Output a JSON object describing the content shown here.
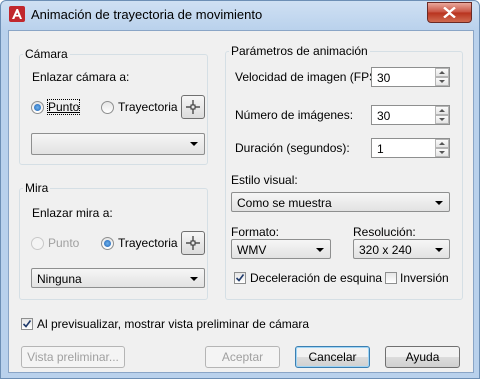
{
  "window": {
    "title": "Animación de trayectoria de movimiento"
  },
  "camera": {
    "group_label": "Cámara",
    "link_label": "Enlazar cámara a:",
    "option_point": "Punto",
    "option_path": "Trayectoria",
    "selected": "Punto",
    "dropdown_value": ""
  },
  "target": {
    "group_label": "Mira",
    "link_label": "Enlazar mira a:",
    "option_point": "Punto",
    "option_path": "Trayectoria",
    "selected": "Trayectoria",
    "dropdown_value": "Ninguna"
  },
  "animation": {
    "group_label": "Parámetros de animación",
    "fps_label": "Velocidad de imagen (FPS):",
    "fps_value": "30",
    "frames_label": "Número de imágenes:",
    "frames_value": "30",
    "duration_label": "Duración (segundos):",
    "duration_value": "1",
    "visual_style_label": "Estilo visual:",
    "visual_style_value": "Como se muestra",
    "format_label": "Formato:",
    "format_value": "WMV",
    "resolution_label": "Resolución:",
    "resolution_value": "320 x 240",
    "corner_decel_label": "Deceleración de esquina",
    "corner_decel_checked": true,
    "reverse_label": "Inversión",
    "reverse_checked": false
  },
  "preview_checkbox": {
    "label": "Al previsualizar, mostrar vista preliminar de cámara",
    "checked": true
  },
  "buttons": {
    "preview": "Vista preliminar...",
    "ok": "Aceptar",
    "cancel": "Cancelar",
    "help": "Ayuda"
  },
  "icons": [
    "autocad-app-icon",
    "close-icon",
    "pick-point-icon",
    "dropdown-arrow-icon",
    "checkmark-icon"
  ]
}
